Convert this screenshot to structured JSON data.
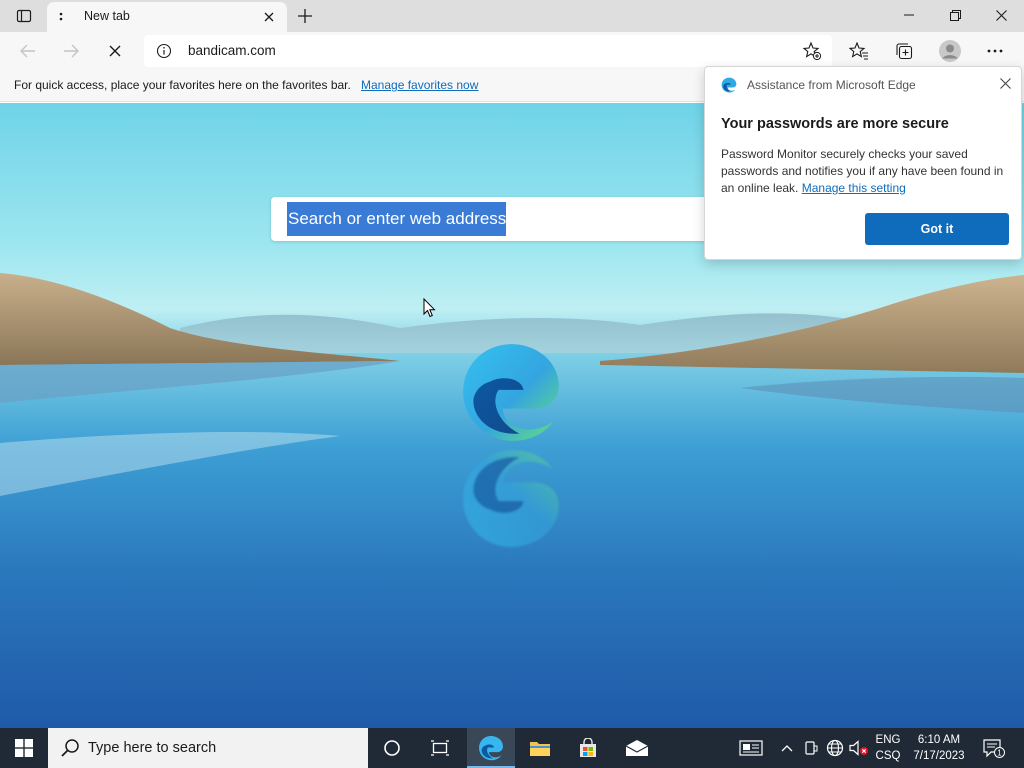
{
  "tab": {
    "title": "New tab"
  },
  "address": {
    "url": "bandicam.com"
  },
  "favorites_bar": {
    "message": "For quick access, place your favorites here on the favorites bar.",
    "link": "Manage favorites now"
  },
  "search": {
    "placeholder": "Search or enter web address"
  },
  "popup": {
    "header": "Assistance from Microsoft Edge",
    "title": "Your passwords are more secure",
    "body": "Password Monitor securely checks your saved passwords and notifies you if any have been found in an online leak.",
    "link": "Manage this setting",
    "button": "Got it"
  },
  "taskbar": {
    "search_placeholder": "Type here to search",
    "lang_top": "ENG",
    "lang_bottom": "CSQ",
    "time": "6:10 AM",
    "date": "7/17/2023",
    "notification_count": "1"
  },
  "colors": {
    "accent": "#0f6cbd",
    "taskbar": "#1f2a36"
  }
}
